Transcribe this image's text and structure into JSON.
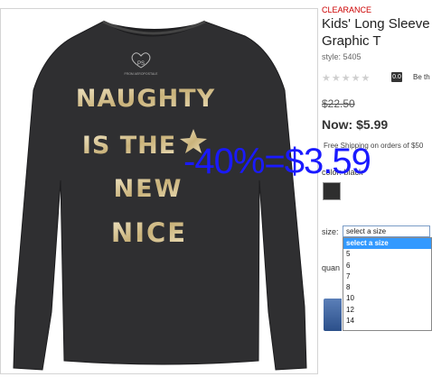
{
  "product": {
    "badge": "CLEARANCE",
    "title_line1": "Kids' Long Sleeve",
    "title_line2": "Graphic T",
    "style": "style: 5405",
    "stars": "★★★★★",
    "rating": "0.0",
    "review_prompt": "Be th",
    "was_price": "$22.50",
    "now_price": "Now: $5.99",
    "shipping": "Free Shipping on orders of $50",
    "color_label": "color: black",
    "swatch_color": "#2e2e2e",
    "size_label": "size:",
    "size_placeholder": "select a size",
    "size_options": [
      "select a size",
      "5",
      "6",
      "7",
      "8",
      "10",
      "12",
      "14"
    ],
    "selected_option": "select a size",
    "quantity_label": "quan"
  },
  "shirt_graphic": {
    "line1": "NAUGHTY",
    "line2": "IS THE",
    "line3": "NEW",
    "line4": "NICE",
    "logo_text": "PS",
    "logo_sub": "FROM AEROPOSTALE"
  },
  "overlay_text": "-40%=$3.59",
  "colors": {
    "clearance": "#cc0000",
    "overlay": "#1a1aff",
    "shirt": "#2f2f31",
    "gold": "#d8c79a",
    "select_highlight": "#3399ff"
  }
}
